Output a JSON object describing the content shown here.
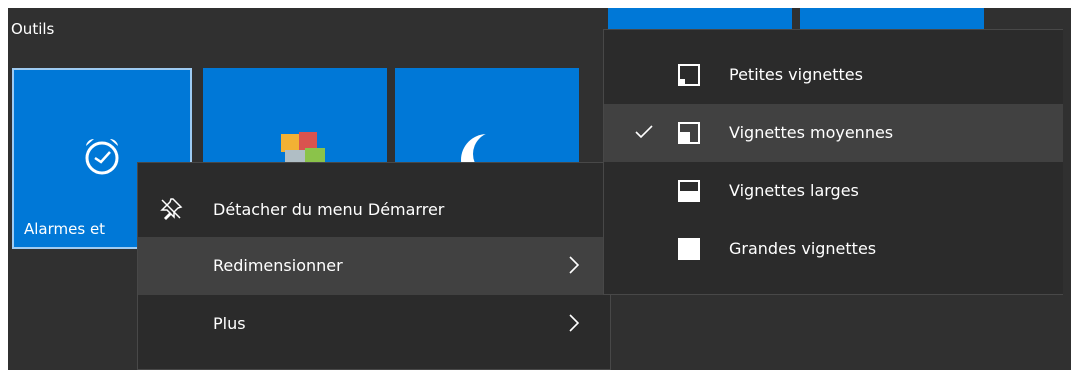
{
  "group": {
    "title": "Outils"
  },
  "tiles": [
    {
      "label": "Alarmes et",
      "icon": "alarm-clock-icon"
    },
    {
      "label": "",
      "icon": "cubes-icon"
    },
    {
      "label": "",
      "icon": "moon-icon"
    }
  ],
  "context_menu": {
    "items": [
      {
        "label": "Détacher du menu Démarrer",
        "icon": "unpin-icon",
        "has_submenu": false
      },
      {
        "label": "Redimensionner",
        "icon": "",
        "has_submenu": true,
        "highlighted": true
      },
      {
        "label": "Plus",
        "icon": "",
        "has_submenu": true
      }
    ]
  },
  "resize_submenu": {
    "items": [
      {
        "label": "Petites vignettes",
        "icon": "small-tile-icon",
        "checked": false
      },
      {
        "label": "Vignettes moyennes",
        "icon": "medium-tile-icon",
        "checked": true
      },
      {
        "label": "Vignettes larges",
        "icon": "wide-tile-icon",
        "checked": false
      },
      {
        "label": "Grandes vignettes",
        "icon": "large-tile-icon",
        "checked": false
      }
    ]
  },
  "colors": {
    "accent": "#0078d7",
    "menu_background": "#2b2b2b",
    "menu_highlight": "#414141",
    "start_background": "#303030",
    "text": "#ffffff"
  }
}
